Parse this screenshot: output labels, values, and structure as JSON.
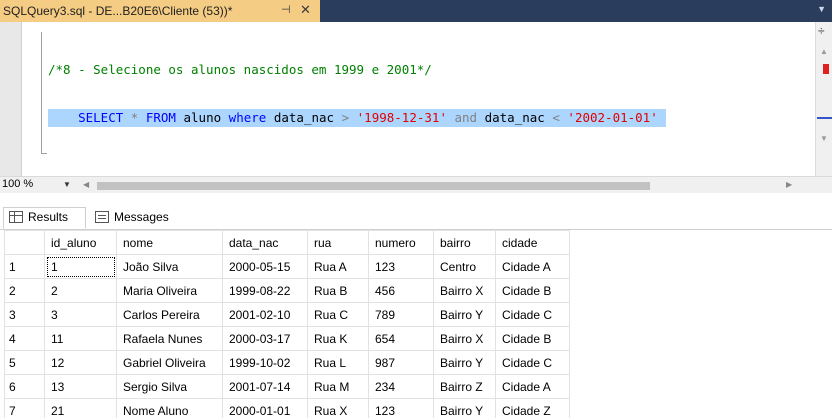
{
  "tab": {
    "title": "SQLQuery3.sql - DE...B20E6\\Cliente (53))*",
    "pin_icon": "pin-icon",
    "close_icon": "close-icon"
  },
  "editor": {
    "comment": "/*8 - Selecione os alunos nascidos em 1999 e 2001*/",
    "tokens": {
      "select": "SELECT",
      "star": "*",
      "from": "FROM",
      "table": "aluno",
      "where": "where",
      "col1": "data_nac",
      "gt": ">",
      "val1": "'1998-12-31'",
      "and": "and",
      "col2": "data_nac",
      "lt": "<",
      "val2": "'2002-01-01'"
    },
    "highlight_color": "#add6ff"
  },
  "zoombar": {
    "zoom": "100 %"
  },
  "results_tabs": [
    {
      "label": "Results",
      "icon": "grid-icon"
    },
    {
      "label": "Messages",
      "icon": "messages-icon"
    }
  ],
  "grid": {
    "columns": [
      "",
      "id_aluno",
      "nome",
      "data_nac",
      "rua",
      "numero",
      "bairro",
      "cidade"
    ],
    "rows": [
      [
        "1",
        "1",
        "João Silva",
        "2000-05-15",
        "Rua A",
        "123",
        "Centro",
        "Cidade A"
      ],
      [
        "2",
        "2",
        "Maria Oliveira",
        "1999-08-22",
        "Rua B",
        "456",
        "Bairro X",
        "Cidade B"
      ],
      [
        "3",
        "3",
        "Carlos Pereira",
        "2001-02-10",
        "Rua C",
        "789",
        "Bairro Y",
        "Cidade C"
      ],
      [
        "4",
        "11",
        "Rafaela Nunes",
        "2000-03-17",
        "Rua K",
        "654",
        "Bairro X",
        "Cidade B"
      ],
      [
        "5",
        "12",
        "Gabriel Oliveira",
        "1999-10-02",
        "Rua L",
        "987",
        "Bairro Y",
        "Cidade C"
      ],
      [
        "6",
        "13",
        "Sergio Silva",
        "2001-07-14",
        "Rua M",
        "234",
        "Bairro Z",
        "Cidade A"
      ],
      [
        "7",
        "21",
        "Nome Aluno",
        "2000-01-01",
        "Rua X",
        "123",
        "Bairro Y",
        "Cidade Z"
      ]
    ]
  }
}
